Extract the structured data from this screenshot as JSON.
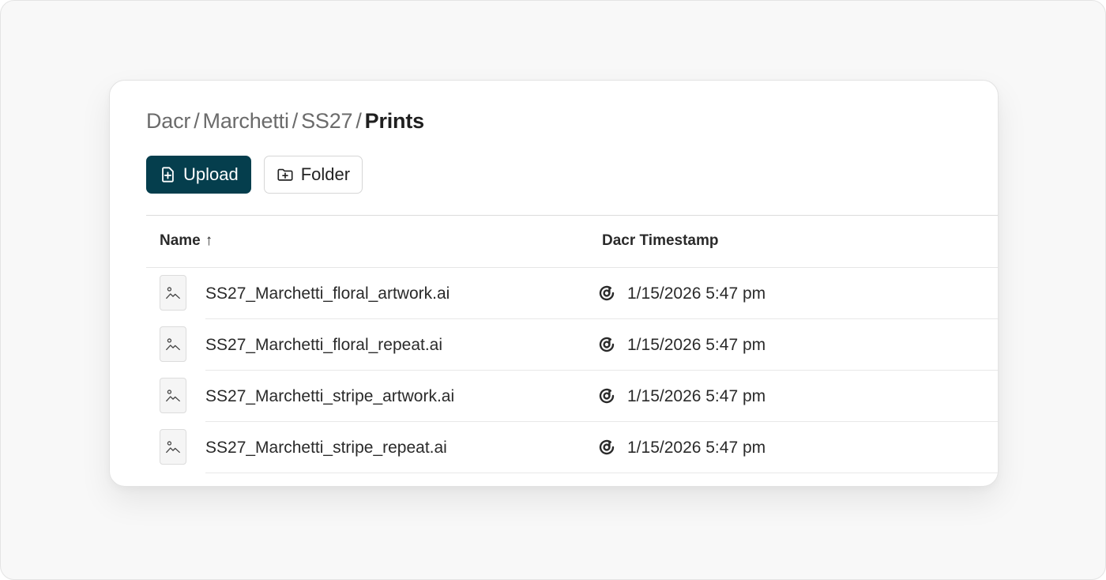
{
  "breadcrumb": {
    "items": [
      "Dacr",
      "Marchetti",
      "SS27"
    ],
    "current": "Prints",
    "separator": "/"
  },
  "toolbar": {
    "upload_label": "Upload",
    "upload_icon": "file-plus-icon",
    "folder_label": "Folder",
    "folder_icon": "folder-plus-icon"
  },
  "table": {
    "columns": {
      "name": "Name",
      "sort_indicator": "↑",
      "timestamp": "Dacr Timestamp"
    },
    "rows": [
      {
        "name": "SS27_Marchetti_floral_artwork.ai",
        "timestamp": "1/15/2026 5:47 pm"
      },
      {
        "name": "SS27_Marchetti_floral_repeat.ai",
        "timestamp": "1/15/2026 5:47 pm"
      },
      {
        "name": "SS27_Marchetti_stripe_artwork.ai",
        "timestamp": "1/15/2026 5:47 pm"
      },
      {
        "name": "SS27_Marchetti_stripe_repeat.ai",
        "timestamp": "1/15/2026 5:47 pm"
      }
    ]
  },
  "colors": {
    "primary": "#053e4d",
    "page_background": "#f8f8f8",
    "card_background": "#ffffff"
  }
}
